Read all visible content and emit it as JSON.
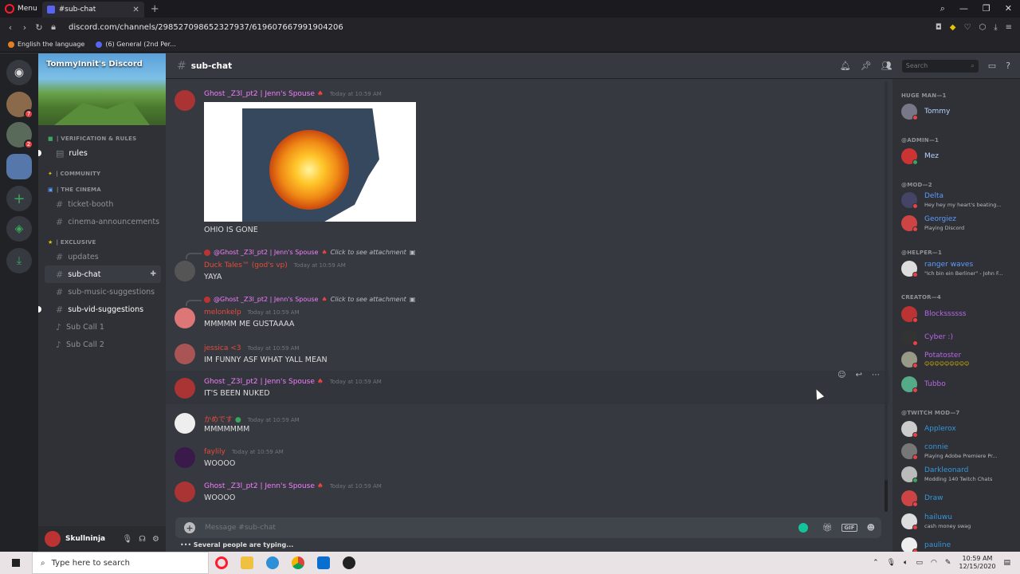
{
  "browser": {
    "menu_label": "Menu",
    "tab_title": "#sub-chat",
    "url": "discord.com/channels/298527098652327937/619607667991904206",
    "bookmarks": [
      "English the language",
      "(6) General (2nd Per..."
    ]
  },
  "server": {
    "name": "TommyInnit's Discord",
    "categories": {
      "verification": "| VERIFICATION & RULES",
      "community": "| COMMUNITY",
      "cinema": "| THE CINEMA",
      "exclusive": "| EXCLUSIVE"
    },
    "channels": {
      "rules": "rules",
      "ticket_booth": "ticket-booth",
      "cinema_announcements": "cinema-announcements",
      "updates": "updates",
      "sub_chat": "sub-chat",
      "sub_music": "sub-music-suggestions",
      "sub_vid": "sub-vid-suggestions",
      "sub_call_1": "Sub Call 1",
      "sub_call_2": "Sub Call 2"
    },
    "guild_mentions": [
      "7",
      "2"
    ]
  },
  "user": {
    "name": "Skullninja"
  },
  "header": {
    "channel": "sub-chat",
    "search_placeholder": "Search"
  },
  "messages": [
    {
      "author": "Ghost _Z3l_pt2 | Jenn's Spouse",
      "time": "Today at 10:59 AM",
      "text": "OHIO IS GONE"
    },
    {
      "reply_author": "@Ghost _Z3l_pt2 | Jenn's Spouse",
      "reply_text": "Click to see attachment",
      "author": "Duck Tales™ (god's vp)",
      "time": "Today at 10:59 AM",
      "text": "YAYA"
    },
    {
      "reply_author": "@Ghost _Z3l_pt2 | Jenn's Spouse",
      "reply_text": "Click to see attachment",
      "author": "melonkelp",
      "time": "Today at 10:59 AM",
      "text": "MMMMM ME GUSTAAAA"
    },
    {
      "author": "jessica <3",
      "time": "Today at 10:59 AM",
      "text": "IM FUNNY ASF WHAT YALL MEAN"
    },
    {
      "author": "Ghost _Z3l_pt2 | Jenn's Spouse",
      "time": "Today at 10:59 AM",
      "text": "IT'S BEEN NUKED"
    },
    {
      "author": "かめです",
      "time": "Today at 10:59 AM",
      "text": "MMMMMMM"
    },
    {
      "author": "faylily",
      "time": "Today at 10:59 AM",
      "text": "WOOOO"
    },
    {
      "author": "Ghost _Z3l_pt2 | Jenn's Spouse",
      "time": "Today at 10:59 AM",
      "text": "WOOOO"
    }
  ],
  "composer": {
    "placeholder": "Message #sub-chat",
    "gif": "GIF"
  },
  "typing": {
    "text": "Several people are typing..."
  },
  "members": {
    "roles": [
      "HUGE MAN—1",
      "@ADMIN—1",
      "@MOD—2",
      "@HELPER—1",
      "CREATOR—4",
      "@TWITCH MOD—7"
    ],
    "list": [
      {
        "name": "Tommy"
      },
      {
        "name": "Mez"
      },
      {
        "name": "Delta",
        "sub": "Hey hey my heart's beating..."
      },
      {
        "name": "Georgiez",
        "sub": "Playing Discord"
      },
      {
        "name": "ranger waves",
        "sub": "\"Ich bin ein Berliner\" - John F..."
      },
      {
        "name": "Blockssssss"
      },
      {
        "name": "Cyber :)"
      },
      {
        "name": "Potatoster",
        "sub": "😊😊😊😊😊😊😊😊😊"
      },
      {
        "name": "Tubbo"
      },
      {
        "name": "Applerox"
      },
      {
        "name": "connie",
        "sub": "Playing Adobe Premiere Pr..."
      },
      {
        "name": "Darkleonard",
        "sub": "Modding 140 Twitch Chats"
      },
      {
        "name": "Draw"
      },
      {
        "name": "hailuwu",
        "sub": "cash money swag"
      },
      {
        "name": "pauline"
      }
    ]
  },
  "taskbar": {
    "search_placeholder": "Type here to search",
    "time": "10:59 AM",
    "date": "12/15/2020"
  },
  "colors": {
    "pink": "#f47fff",
    "purple": "#b768e6",
    "blue": "#3498db",
    "red": "#e74c3c",
    "mod_blue": "#5c9cff"
  }
}
